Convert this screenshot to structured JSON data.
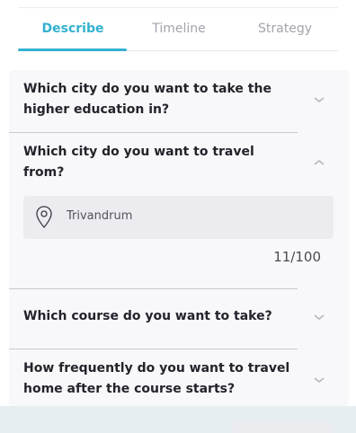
{
  "tabs": [
    {
      "label": "Describe",
      "active": true
    },
    {
      "label": "Timeline",
      "active": false
    },
    {
      "label": "Strategy",
      "active": false
    }
  ],
  "accent_color": "#33b1cf",
  "questions": [
    {
      "text": "Which city do you want to take the higher education in?",
      "expanded": false,
      "icon": "chevron-down-icon"
    },
    {
      "text": "Which city do you want to travel from?",
      "expanded": true,
      "icon": "chevron-up-icon"
    },
    {
      "text": "Which course do you want to take?",
      "expanded": false,
      "icon": "chevron-down-icon"
    },
    {
      "text": "How frequently do you want to travel home after the course starts?",
      "expanded": false,
      "icon": "chevron-down-icon"
    }
  ],
  "travel_from": {
    "icon": "location-pin-icon",
    "value": "Trivandrum",
    "counter": "11/100"
  }
}
